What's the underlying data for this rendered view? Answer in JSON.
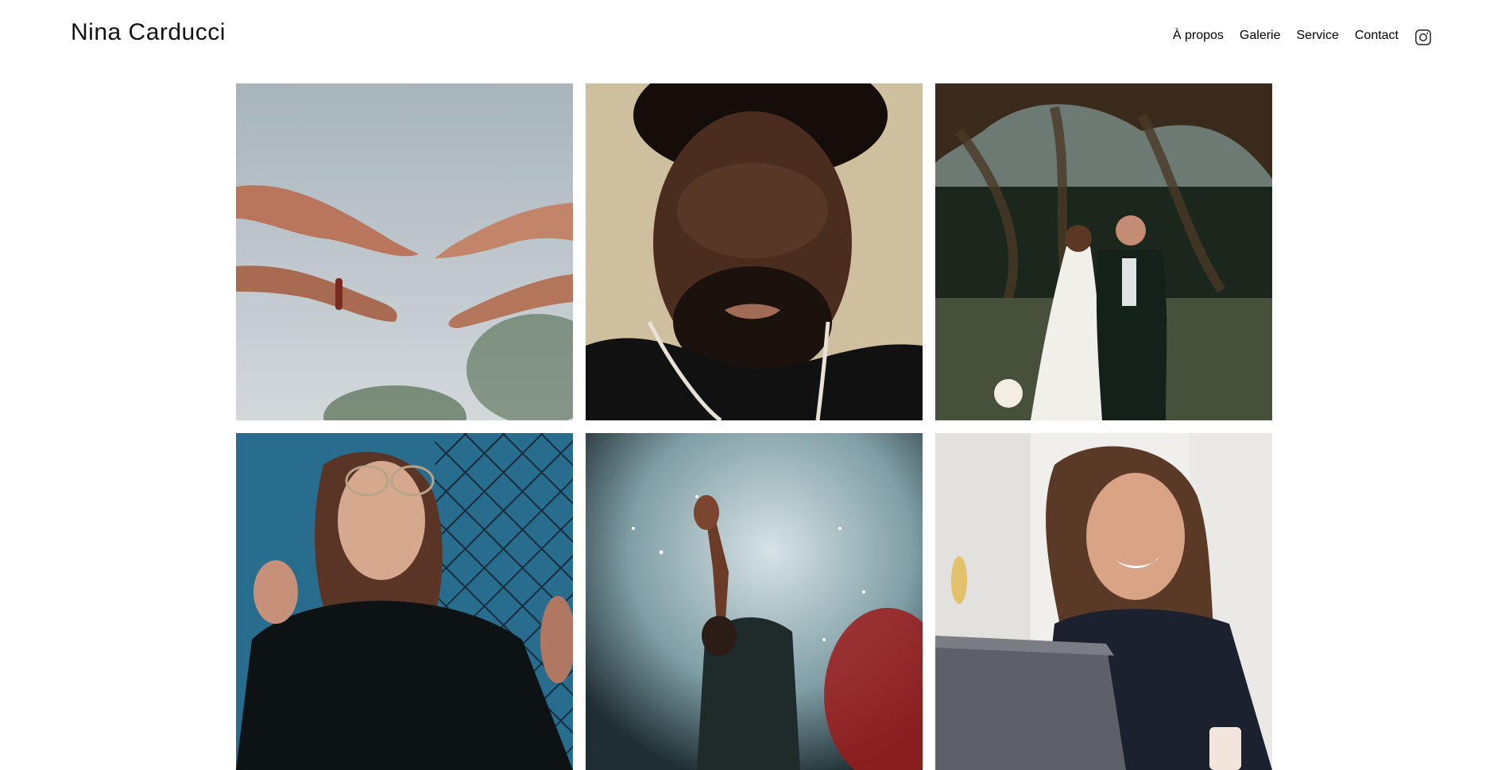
{
  "header": {
    "brand": "Nina Carducci",
    "nav": [
      {
        "label": "À propos"
      },
      {
        "label": "Galerie"
      },
      {
        "label": "Service"
      },
      {
        "label": "Contact"
      }
    ],
    "social_icon": "instagram-icon"
  },
  "gallery": {
    "items": [
      {
        "subject": "hands-reaching",
        "palette": [
          "#9aa8b2",
          "#c8cfd3",
          "#b06a52",
          "#3f5a3a"
        ]
      },
      {
        "subject": "man-portrait",
        "palette": [
          "#cbb89a",
          "#3a2418",
          "#111111",
          "#e9e2d6"
        ]
      },
      {
        "subject": "wedding-couple",
        "palette": [
          "#1e2a1e",
          "#3b4a2d",
          "#f2f0ec",
          "#152018"
        ]
      },
      {
        "subject": "woman-glasses",
        "palette": [
          "#2f7fa6",
          "#0e1416",
          "#7a4a35",
          "#c9e0ea"
        ]
      },
      {
        "subject": "concert-performer",
        "palette": [
          "#6f8f98",
          "#c8d6da",
          "#9b1b1b",
          "#1e2b2f"
        ]
      },
      {
        "subject": "woman-laptop",
        "palette": [
          "#f3f1ee",
          "#1c2130",
          "#6b4630",
          "#5c5f66"
        ]
      }
    ]
  }
}
